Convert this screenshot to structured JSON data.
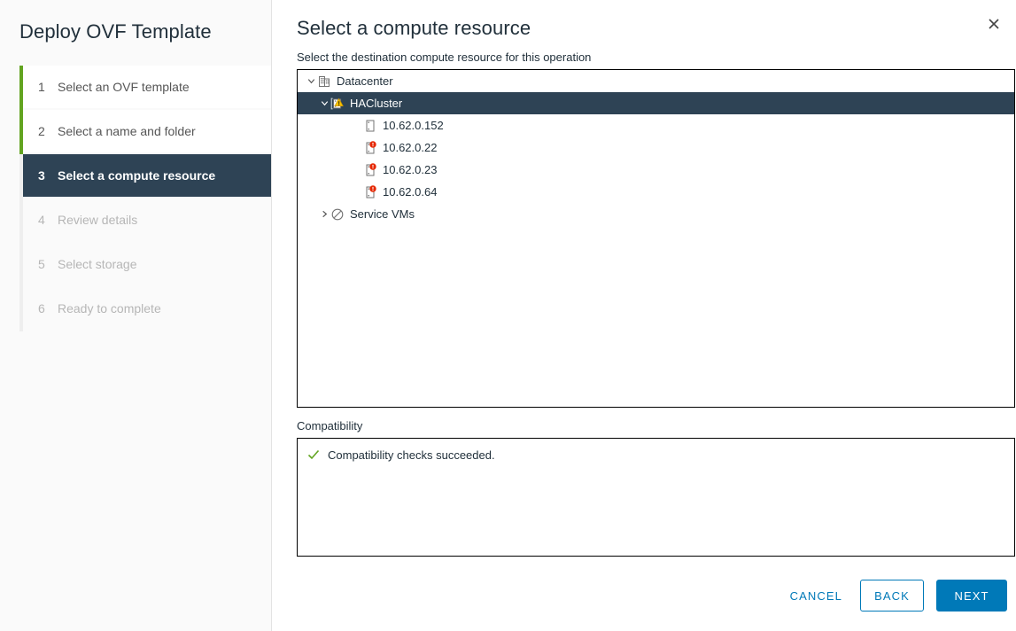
{
  "wizard": {
    "title": "Deploy OVF Template",
    "steps": [
      {
        "num": "1",
        "label": "Select an OVF template",
        "state": "done"
      },
      {
        "num": "2",
        "label": "Select a name and folder",
        "state": "done"
      },
      {
        "num": "3",
        "label": "Select a compute resource",
        "state": "active"
      },
      {
        "num": "4",
        "label": "Review details",
        "state": "todo"
      },
      {
        "num": "5",
        "label": "Select storage",
        "state": "todo"
      },
      {
        "num": "6",
        "label": "Ready to complete",
        "state": "todo"
      }
    ]
  },
  "page": {
    "title": "Select a compute resource",
    "subtitle": "Select the destination compute resource for this operation",
    "close_icon": "close-icon"
  },
  "tree": {
    "nodes": [
      {
        "label": "Datacenter",
        "icon": "datacenter-icon",
        "depth": 0,
        "twisty": "expanded",
        "selected": false,
        "badge": "none"
      },
      {
        "label": "HACluster",
        "icon": "cluster-icon",
        "depth": 1,
        "twisty": "expanded",
        "selected": true,
        "badge": "warning"
      },
      {
        "label": "10.62.0.152",
        "icon": "host-icon",
        "depth": 2,
        "twisty": "none",
        "selected": false,
        "badge": "none"
      },
      {
        "label": "10.62.0.22",
        "icon": "host-icon",
        "depth": 2,
        "twisty": "none",
        "selected": false,
        "badge": "error"
      },
      {
        "label": "10.62.0.23",
        "icon": "host-icon",
        "depth": 2,
        "twisty": "none",
        "selected": false,
        "badge": "error"
      },
      {
        "label": "10.62.0.64",
        "icon": "host-icon",
        "depth": 2,
        "twisty": "none",
        "selected": false,
        "badge": "error"
      },
      {
        "label": "Service VMs",
        "icon": "resource-pool-icon",
        "depth": 1,
        "twisty": "collapsed",
        "selected": false,
        "badge": "none"
      }
    ]
  },
  "compatibility": {
    "label": "Compatibility",
    "status_icon": "check-icon",
    "message": "Compatibility checks succeeded."
  },
  "footer": {
    "cancel_label": "CANCEL",
    "back_label": "BACK",
    "next_label": "NEXT"
  },
  "colors": {
    "accent_blue": "#0079b8",
    "active_step": "#2e4355",
    "progress_green": "#62a420",
    "error_red": "#e62700",
    "warning_yellow": "#fac400",
    "success_green": "#62a420"
  }
}
